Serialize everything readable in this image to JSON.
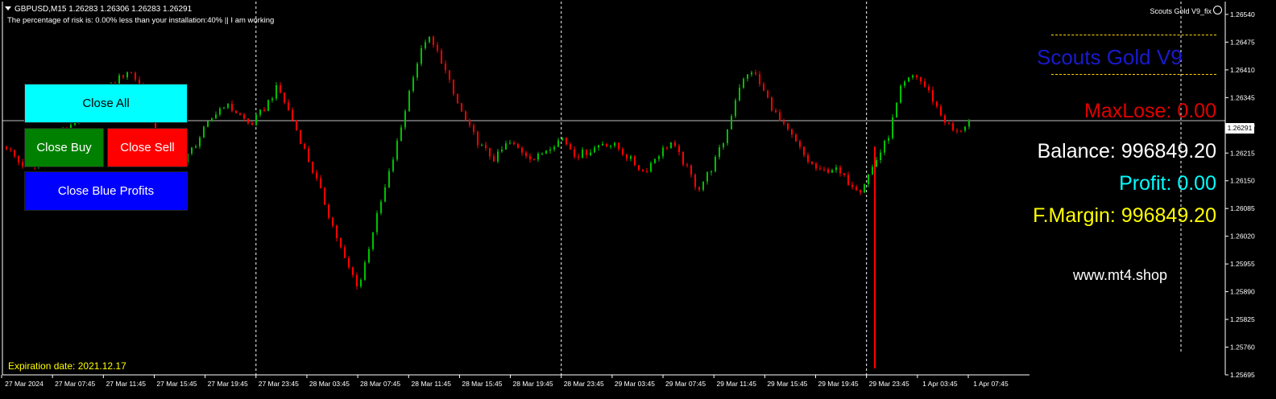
{
  "header": {
    "symbol_line": "GBPUSD,M15  1.26283 1.26306 1.26283 1.26291",
    "risk_line": "The percentage of risk is: 0.00%  less than your installation:40%  || I am working"
  },
  "indicator_name": "Scouts Gold V9_fix",
  "buttons": {
    "close_all": "Close All",
    "close_buy": "Close Buy",
    "close_sell": "Close Sell",
    "close_blue": "Close Blue Profits"
  },
  "panel": {
    "title": "Scouts Gold V9",
    "maxlose": "MaxLose: 0.00",
    "balance": "Balance: 996849.20",
    "profit": "Profit: 0.00",
    "fmargin": "F.Margin: 996849.20",
    "site": "www.mt4.shop"
  },
  "expiration": "Expiration date: 2021.12.17",
  "current_price_label": "1.26291",
  "colors": {
    "background": "#000000",
    "bull": "#00c000",
    "bear": "#ff0000",
    "axis": "#ffffff",
    "cyan": "#00ffff",
    "yellow": "#ffff00"
  },
  "chart_data": {
    "type": "candlestick",
    "current_price": 1.26291,
    "ylim": [
      1.25695,
      1.2657
    ],
    "y_ticks": [
      1.2654,
      1.26475,
      1.2641,
      1.26345,
      1.2628,
      1.26215,
      1.2615,
      1.26085,
      1.2602,
      1.25955,
      1.2589,
      1.25825,
      1.2576,
      1.25695
    ],
    "y_tick_labels": [
      "1.26540",
      "1.26475",
      "1.26410",
      "1.26345",
      "1.26280",
      "1.26215",
      "1.26150",
      "1.26085",
      "1.26020",
      "1.25955",
      "1.25890",
      "1.25825",
      "1.25760",
      "1.25695"
    ],
    "x_labels": [
      "27 Mar 2024",
      "27 Mar 07:45",
      "27 Mar 11:45",
      "27 Mar 15:45",
      "27 Mar 19:45",
      "27 Mar 23:45",
      "28 Mar 03:45",
      "28 Mar 07:45",
      "28 Mar 11:45",
      "28 Mar 15:45",
      "28 Mar 19:45",
      "28 Mar 23:45",
      "29 Mar 03:45",
      "29 Mar 07:45",
      "29 Mar 11:45",
      "29 Mar 15:45",
      "29 Mar 19:45",
      "29 Mar 23:45",
      "1 Apr 03:45",
      "1 Apr 07:45"
    ],
    "day_separators": [
      "27 Mar 23:45",
      "28 Mar 23:45",
      "29 Mar 23:45"
    ],
    "close_path": [
      1.2623,
      1.2619,
      1.2618,
      1.2622,
      1.2626,
      1.2629,
      1.2631,
      1.2635,
      1.2638,
      1.2641,
      1.2637,
      1.2625,
      1.2621,
      1.2619,
      1.2624,
      1.2629,
      1.2633,
      1.2631,
      1.2628,
      1.2632,
      1.2637,
      1.263,
      1.2622,
      1.2614,
      1.2605,
      1.2596,
      1.259,
      1.2603,
      1.2614,
      1.2626,
      1.264,
      1.2649,
      1.2644,
      1.2635,
      1.2628,
      1.2623,
      1.262,
      1.2624,
      1.2622,
      1.262,
      1.2623,
      1.2625,
      1.2621,
      1.2622,
      1.2624,
      1.2623,
      1.262,
      1.2617,
      1.2621,
      1.2624,
      1.2619,
      1.2613,
      1.2618,
      1.2625,
      1.2637,
      1.2641,
      1.2635,
      1.2629,
      1.2625,
      1.262,
      1.2617,
      1.2618,
      1.2615,
      1.2613,
      1.2619,
      1.2625,
      1.2637,
      1.264,
      1.2636,
      1.263,
      1.2626,
      1.2629
    ],
    "spike_low": 1.2571
  }
}
